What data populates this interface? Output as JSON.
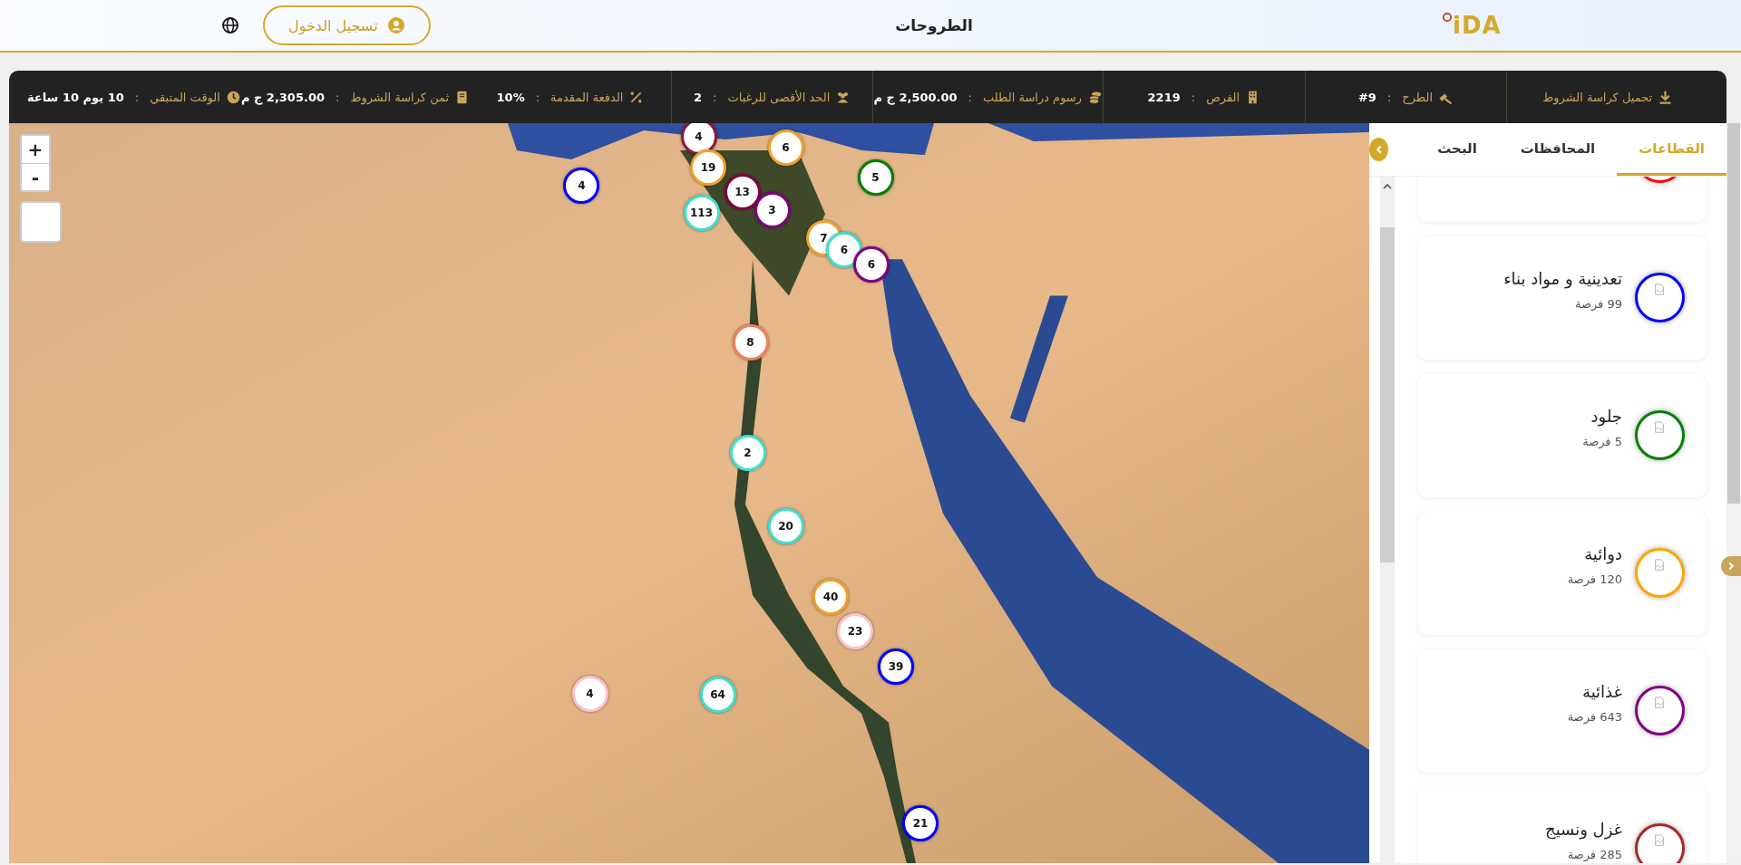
{
  "header": {
    "logo": "iDA",
    "title": "الطروحات",
    "login_button": "تسجيل الدخول"
  },
  "info_bar": [
    {
      "kind": "link",
      "label": "تحميل كراسة الشروط"
    },
    {
      "kind": "field",
      "label": "الطرح",
      "sep": ":",
      "value": "#9"
    },
    {
      "kind": "field",
      "label": "الفرص",
      "sep": ":",
      "value": "2219"
    },
    {
      "kind": "field",
      "label": "رسوم دراسة الطلب",
      "sep": ":",
      "value": "2,500.00 ج م"
    },
    {
      "kind": "field",
      "label": "الحد الأقصى للرغبات",
      "sep": ":",
      "value": "2"
    },
    {
      "kind": "field",
      "label": "الدفعة المقدمة",
      "sep": ":",
      "value": "10%"
    },
    {
      "kind": "field",
      "label": "ثمن كراسة الشروط",
      "sep": ":",
      "value": "2,305.00 ج م"
    },
    {
      "kind": "field",
      "label": "الوقت المتبقي",
      "sep": ":",
      "value": "10 يوم 10 ساعة"
    }
  ],
  "sidebar": {
    "tabs": [
      {
        "label": "القطاعات",
        "selected": true
      },
      {
        "label": "المحافظات",
        "selected": false
      },
      {
        "label": "البحث",
        "selected": false
      }
    ],
    "sectors": [
      {
        "color": "#ff0000"
      },
      {
        "name": "تعدينية و مواد بناء",
        "count": "99 فرصة",
        "color": "#0000ff"
      },
      {
        "name": "جلود",
        "count": "5 فرصة",
        "color": "#008000"
      },
      {
        "name": "دوائية",
        "count": "120 فرصة",
        "color": "#ffa500"
      },
      {
        "name": "غذائية",
        "count": "643 فرصة",
        "color": "#800080"
      },
      {
        "name": "غزل ونسيج",
        "count": "285 فرصة",
        "color": "#a52a2a"
      }
    ]
  },
  "map": {
    "zoom_in": "+",
    "zoom_out": "-",
    "markers": [
      {
        "count": "4",
        "color": "#8b1a3a"
      },
      {
        "count": "6",
        "color": "#f0a030"
      },
      {
        "count": "19",
        "color": "#f0a030"
      },
      {
        "count": "4",
        "color": "#0000ff"
      },
      {
        "count": "13",
        "color": "#800040"
      },
      {
        "count": "5",
        "color": "#008000"
      },
      {
        "count": "3",
        "color": "#800080"
      },
      {
        "count": "113",
        "color": "#40e0d0"
      },
      {
        "count": "7",
        "color": "#f0a030"
      },
      {
        "count": "6",
        "color": "#40e0d0"
      },
      {
        "count": "6",
        "color": "#800080"
      },
      {
        "count": "8",
        "color": "#f08060"
      },
      {
        "count": "2",
        "color": "#40e0d0"
      },
      {
        "count": "20",
        "color": "#40e0d0"
      },
      {
        "count": "40",
        "color": "#f0a030"
      },
      {
        "count": "23",
        "color": "#ffc0cb"
      },
      {
        "count": "39",
        "color": "#0000ff"
      },
      {
        "count": "4",
        "color": "#ffc0cb"
      },
      {
        "count": "64",
        "color": "#40e0d0"
      },
      {
        "count": "21",
        "color": "#0000ff"
      }
    ]
  }
}
